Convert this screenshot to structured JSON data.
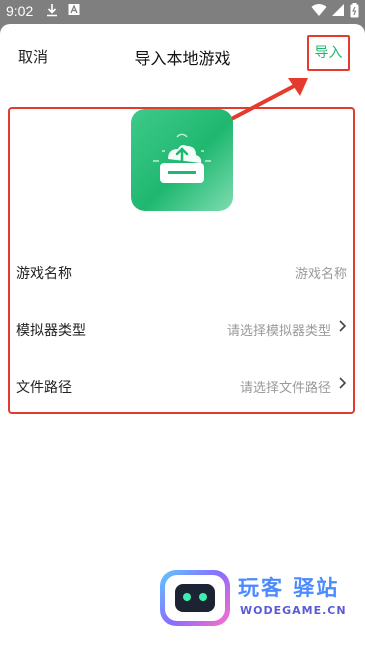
{
  "status_bar": {
    "time": "9:02",
    "icons": [
      "download-icon",
      "a-icon",
      "wifi-icon",
      "signal-icon",
      "battery-icon"
    ]
  },
  "header": {
    "cancel_label": "取消",
    "title": "导入本地游戏",
    "import_label": "导入"
  },
  "form": {
    "rows": [
      {
        "label": "游戏名称",
        "placeholder": "游戏名称",
        "has_chevron": false
      },
      {
        "label": "模拟器类型",
        "placeholder": "请选择模拟器类型",
        "has_chevron": true
      },
      {
        "label": "文件路径",
        "placeholder": "请选择文件路径",
        "has_chevron": true
      }
    ]
  },
  "watermark": {
    "title": "玩客 驿站",
    "url": "WODEGAME.CN"
  },
  "colors": {
    "accent": "#1fb870",
    "annotation": "#e53b2e"
  }
}
